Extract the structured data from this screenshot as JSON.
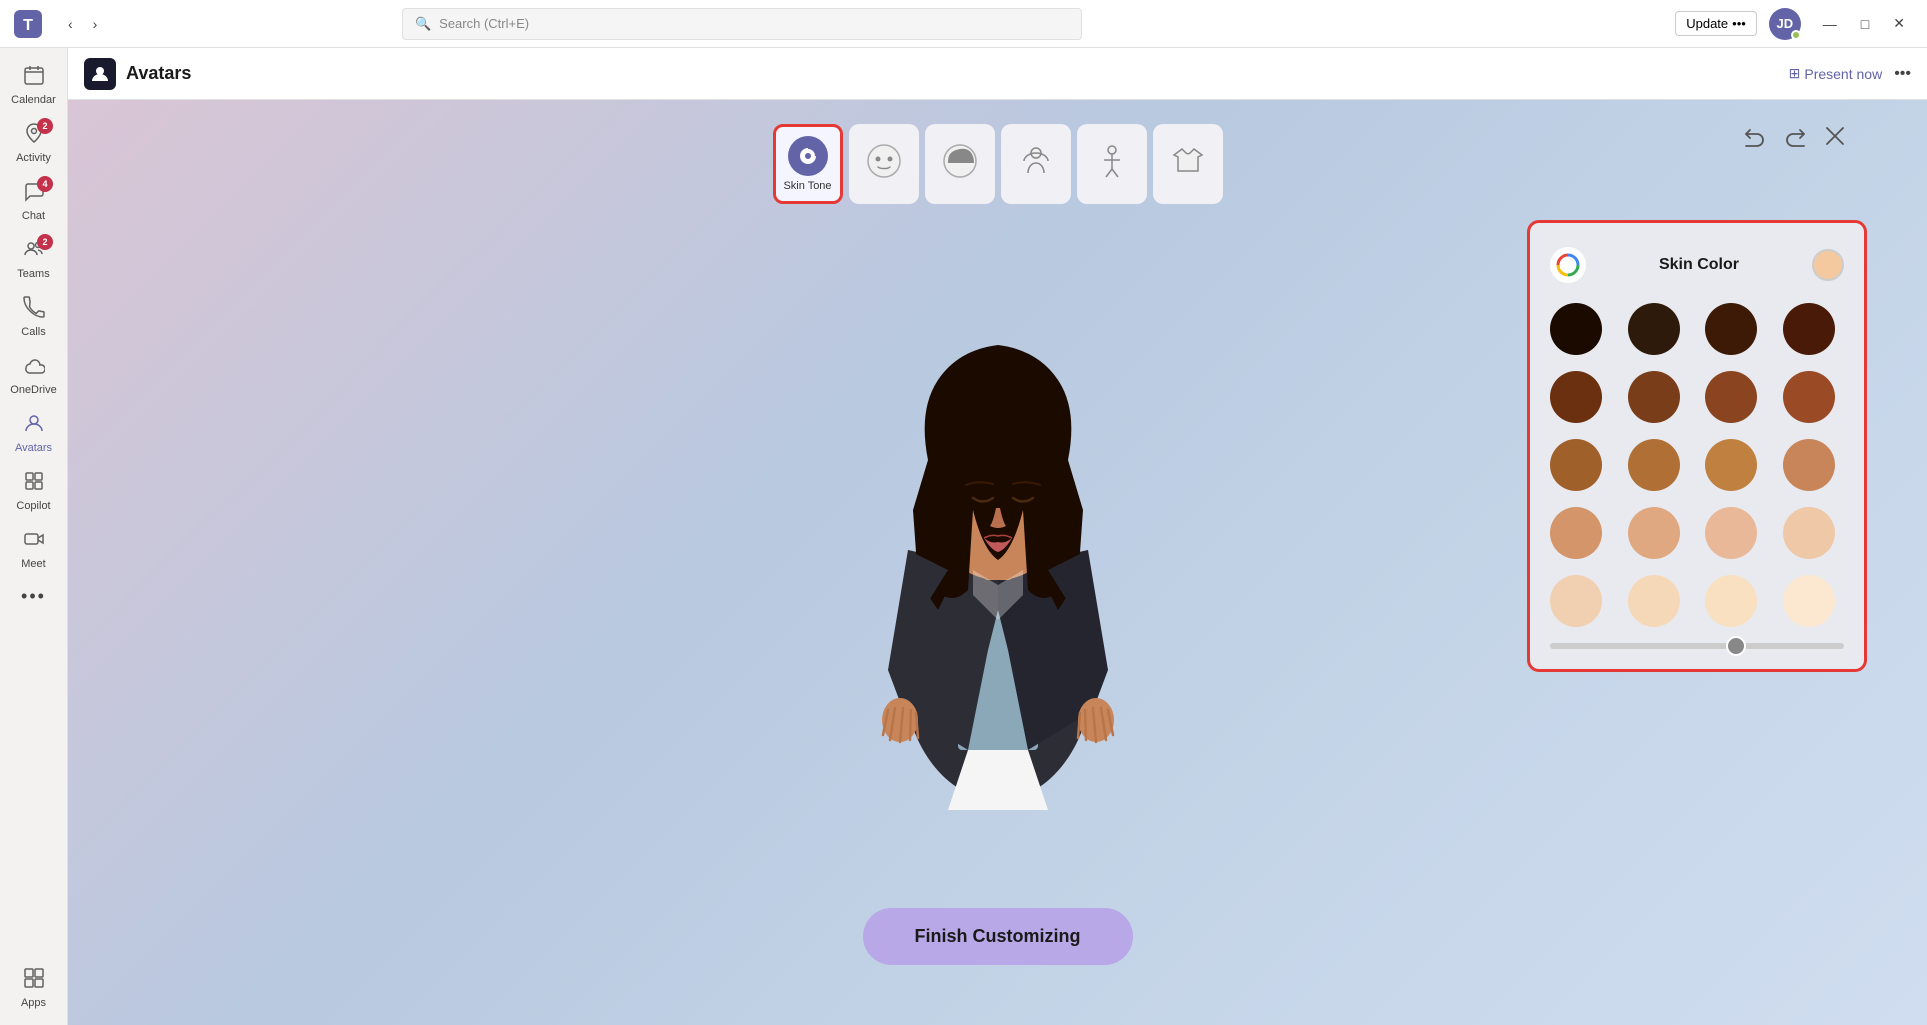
{
  "titlebar": {
    "search_placeholder": "Search (Ctrl+E)",
    "update_label": "Update",
    "update_dots": "•••",
    "minimize_label": "—",
    "maximize_label": "□",
    "close_label": "✕"
  },
  "sidebar": {
    "items": [
      {
        "id": "calendar",
        "label": "Calendar",
        "icon": "📅",
        "badge": null
      },
      {
        "id": "activity",
        "label": "Activity",
        "icon": "🔔",
        "badge": "2"
      },
      {
        "id": "chat",
        "label": "Chat",
        "icon": "💬",
        "badge": "4"
      },
      {
        "id": "teams",
        "label": "Teams",
        "icon": "👥",
        "badge": "2"
      },
      {
        "id": "calls",
        "label": "Calls",
        "icon": "📞",
        "badge": null
      },
      {
        "id": "onedrive",
        "label": "OneDrive",
        "icon": "☁",
        "badge": null
      },
      {
        "id": "avatars",
        "label": "Avatars",
        "icon": "🧍",
        "badge": null,
        "active": true
      },
      {
        "id": "copilot",
        "label": "Copilot",
        "icon": "⚡",
        "badge": null
      },
      {
        "id": "meet",
        "label": "Meet",
        "icon": "🎥",
        "badge": null
      },
      {
        "id": "more",
        "label": "•••",
        "icon": "•••",
        "badge": null
      }
    ],
    "bottom_items": [
      {
        "id": "apps",
        "label": "Apps",
        "icon": "⊞",
        "badge": null
      }
    ]
  },
  "app_header": {
    "icon": "🧍",
    "title": "Avatars",
    "present_now": "Present now",
    "more_icon": "•••"
  },
  "toolbar": {
    "items": [
      {
        "id": "skin-tone",
        "label": "Skin Tone",
        "icon": "🎨",
        "active": true
      },
      {
        "id": "face",
        "label": "",
        "icon": "😊",
        "active": false
      },
      {
        "id": "hair",
        "label": "",
        "icon": "💇",
        "active": false
      },
      {
        "id": "body",
        "label": "",
        "icon": "👥",
        "active": false
      },
      {
        "id": "pose",
        "label": "",
        "icon": "🧍",
        "active": false
      },
      {
        "id": "outfit",
        "label": "",
        "icon": "👕",
        "active": false
      }
    ],
    "undo_label": "↩",
    "redo_label": "↪",
    "close_label": "✕"
  },
  "finish_btn": {
    "label": "Finish Customizing"
  },
  "skin_panel": {
    "title": "Skin Color",
    "google_icon": "🌈",
    "selected_color": "#f5c9a0",
    "colors": [
      "#1a0a00",
      "#2d1a0a",
      "#3d1a05",
      "#4a1a08",
      "#6b3010",
      "#7a3d1a",
      "#8a4520",
      "#9a4a25",
      "#a0602a",
      "#b07035",
      "#c08040",
      "#c8855a",
      "#d4956a",
      "#dfa880",
      "#e8b898",
      "#efc8a8",
      "#f0d0b0",
      "#f5d8b8",
      "#f8e0c0",
      "#fce8d0"
    ],
    "slider_value": 60
  }
}
